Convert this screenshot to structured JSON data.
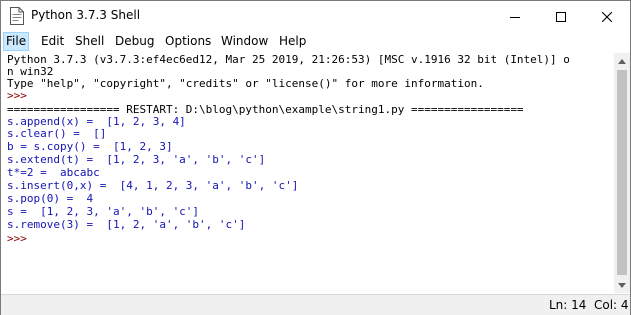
{
  "window": {
    "title": "Python 3.7.3 Shell"
  },
  "menu": [
    "File",
    "Edit",
    "Shell",
    "Debug",
    "Options",
    "Window",
    "Help"
  ],
  "shell_lines": [
    {
      "text": "Python 3.7.3 (v3.7.3:ef4ec6ed12, Mar 25 2019, 21:26:53) [MSC v.1916 32 bit (Intel)] o",
      "kind": "std"
    },
    {
      "text": "n win32",
      "kind": "std"
    },
    {
      "text": "Type \"help\", \"copyright\", \"credits\" or \"license()\" for more information.",
      "kind": "std"
    },
    {
      "text": ">>> ",
      "kind": "prompt"
    },
    {
      "text": "================= RESTART: D:\\blog\\python\\example\\string1.py =================",
      "kind": "restart"
    },
    {
      "text": "s.append(x) =  [1, 2, 3, 4]",
      "kind": "out"
    },
    {
      "text": "s.clear() =  []",
      "kind": "out"
    },
    {
      "text": "b = s.copy() =  [1, 2, 3]",
      "kind": "out"
    },
    {
      "text": "s.extend(t) =  [1, 2, 3, 'a', 'b', 'c']",
      "kind": "out"
    },
    {
      "text": "t*=2 =  abcabc",
      "kind": "out"
    },
    {
      "text": "s.insert(0,x) =  [4, 1, 2, 3, 'a', 'b', 'c']",
      "kind": "out"
    },
    {
      "text": "s.pop(0) =  4",
      "kind": "out"
    },
    {
      "text": "s =  [1, 2, 3, 'a', 'b', 'c']",
      "kind": "out"
    },
    {
      "text": "s.remove(3) =  [1, 2, 'a', 'b', 'c']",
      "kind": "out"
    },
    {
      "text": ">>> ",
      "kind": "prompt"
    }
  ],
  "status": {
    "line": "Ln: 14",
    "col": "Col: 4"
  },
  "colors": {
    "output": "#1414b4",
    "prompt": "#8b0000",
    "menu_active": "#cce8ff"
  }
}
